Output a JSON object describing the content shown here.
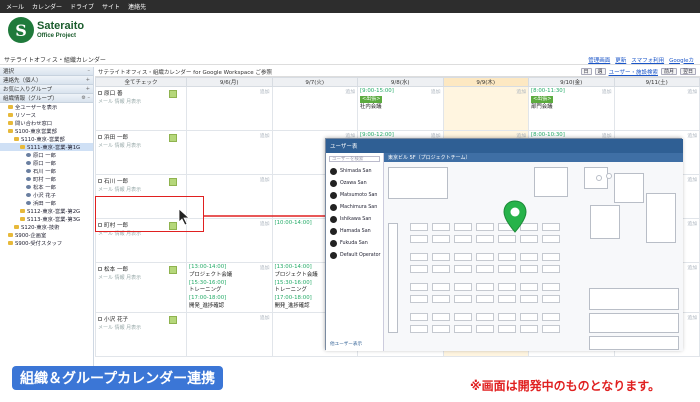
{
  "topbar": {
    "items": [
      "メール",
      "カレンダー",
      "ドライブ",
      "サイト",
      "連絡先"
    ]
  },
  "logo": {
    "letter": "S",
    "main": "Sateraito",
    "sub": "Office Project"
  },
  "page_title": "サテライトオフィス・組織カレンダー",
  "header_links": [
    "管理画面",
    "更新",
    "スマフォ利用",
    "Googleカ"
  ],
  "sidebar": {
    "section1": "選択",
    "contacts": "連絡先（個人）",
    "favorites": "お気に入りグループ",
    "org": "組織情報（グループ）",
    "tree": [
      {
        "label": "全ユーザーを表示",
        "indent": 1,
        "type": "folder"
      },
      {
        "label": "リソース",
        "indent": 1,
        "type": "folder"
      },
      {
        "label": "問い合わせ窓口",
        "indent": 1,
        "type": "folder"
      },
      {
        "label": "S100-東京営業部",
        "indent": 1,
        "type": "folder"
      },
      {
        "label": "S110-東京-営業部",
        "indent": 2,
        "type": "folder"
      },
      {
        "label": "S111-東京-営業-第1G",
        "indent": 3,
        "type": "folder",
        "selected": true
      },
      {
        "label": "原口 一郎",
        "indent": 4,
        "type": "person"
      },
      {
        "label": "原口 一郎",
        "indent": 4,
        "type": "person"
      },
      {
        "label": "石川 一郎",
        "indent": 4,
        "type": "person"
      },
      {
        "label": "町村 一郎",
        "indent": 4,
        "type": "person"
      },
      {
        "label": "松本 一郎",
        "indent": 4,
        "type": "person"
      },
      {
        "label": "小沢 花子",
        "indent": 4,
        "type": "person"
      },
      {
        "label": "浜田 一郎",
        "indent": 4,
        "type": "person"
      },
      {
        "label": "S112-東京-営業-第2G",
        "indent": 3,
        "type": "folder"
      },
      {
        "label": "S113-東京-営業-第3G",
        "indent": 3,
        "type": "folder"
      },
      {
        "label": "S120-東京-技術",
        "indent": 2,
        "type": "folder"
      },
      {
        "label": "S900-企画室",
        "indent": 1,
        "type": "folder"
      },
      {
        "label": "S900-受付スタッフ",
        "indent": 1,
        "type": "folder"
      }
    ]
  },
  "toolbar": {
    "title": "サテライトオフィス・組織カレンダー for Google Workspace ご参照",
    "user_link": "ユーザー・施設検索",
    "prev": "前月",
    "next": "翌日"
  },
  "calendar": {
    "check_all": "全てチェック",
    "days": [
      "9/6(月)",
      "9/7(火)",
      "9/8(水)",
      "9/9(木)",
      "9/10(金)",
      "9/11(土)"
    ],
    "add_label": "追加",
    "row_sub": "メール 情報 月表示",
    "rows": [
      {
        "name": "原口 善",
        "events": [
          [],
          [],
          [
            "[9:00-15:00]",
            "<出張>",
            "社内会議"
          ],
          [],
          [
            "[8:00-11:30]",
            "<出張>",
            "部門会議"
          ],
          []
        ]
      },
      {
        "name": "浜田 一郎",
        "events": [
          [],
          [],
          [
            "[9:00-12:00]"
          ],
          [],
          [
            "[8:00-10:30]"
          ],
          []
        ]
      },
      {
        "name": "石川 一郎",
        "events": [
          [],
          [],
          [],
          [],
          [],
          []
        ]
      },
      {
        "name": "町村 一郎",
        "events": [
          [],
          [
            "[10:00-14:00]"
          ],
          [],
          [],
          [],
          []
        ]
      },
      {
        "name": "松本 一郎",
        "events": [
          [
            "[13:00-14:00]",
            "プロジェクト会議",
            "[15:30-16:00]",
            "トレーニング",
            "[17:00-18:00]",
            "開発_進捗確認"
          ],
          [
            "[13:00-14:00]",
            "プロジェクト会議",
            "[15:30-16:00]",
            "トレーニング",
            "[17:00-18:00]",
            "開発_進捗確認"
          ],
          [],
          [],
          [],
          []
        ]
      },
      {
        "name": "小沢 花子",
        "events": [
          [],
          [],
          [],
          [],
          [],
          []
        ]
      }
    ]
  },
  "overlay": {
    "header": "ユーザー表",
    "search_placeholder": "ユーザーを検索",
    "location": "東京ビル 5F（プロジェクトチーム）",
    "users": [
      "Shimada San",
      "Ozawa San",
      "Matsumoto San",
      "Machimura San",
      "Ishikawa San",
      "Hamada San",
      "Fukuda San",
      "Default Operator"
    ],
    "footer": "他ユーザー表示"
  },
  "banner": "組織＆グループカレンダー連携",
  "note": "※画面は開発中のものとなります。",
  "colors": {
    "highlight": "#e02020",
    "banner": "#3b76d6",
    "pin": "#27b34a"
  }
}
